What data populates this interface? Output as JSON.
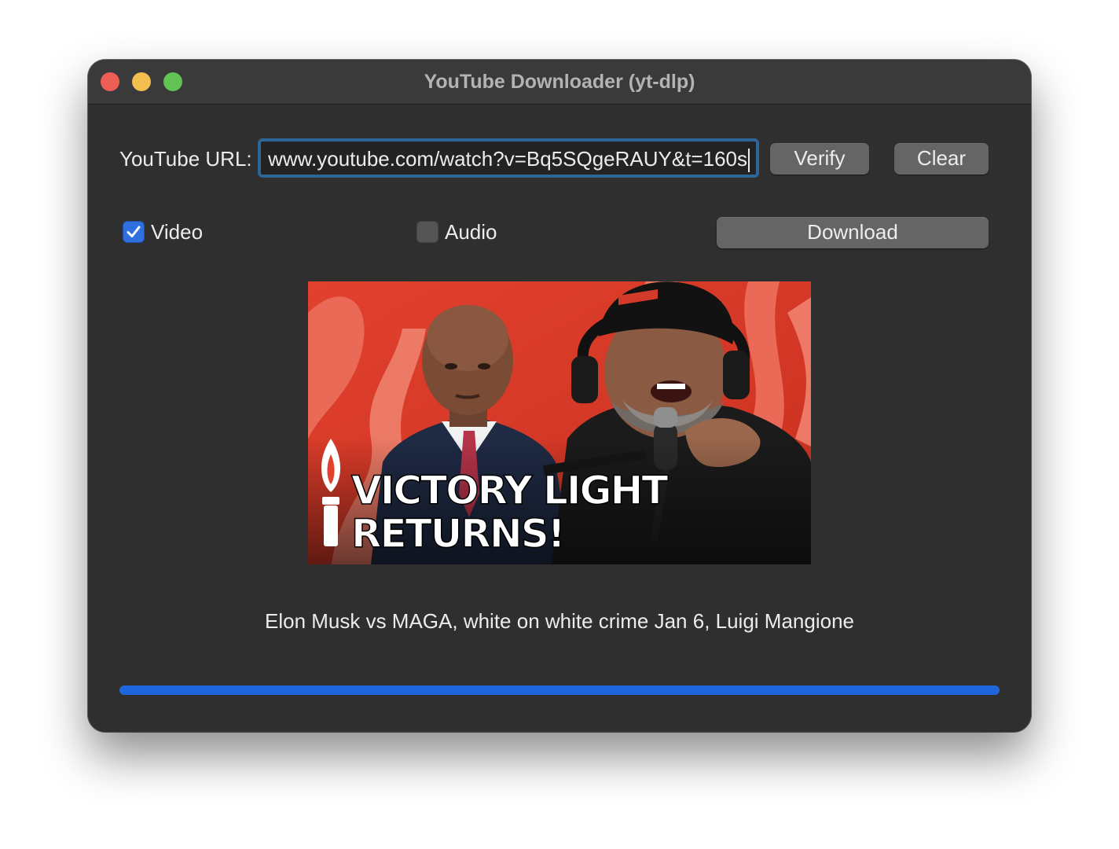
{
  "window": {
    "title": "YouTube Downloader (yt-dlp)"
  },
  "url_row": {
    "label": "YouTube URL:",
    "value": "www.youtube.com/watch?v=Bq5SQgeRAUY&t=160s",
    "verify_label": "Verify",
    "clear_label": "Clear"
  },
  "options": {
    "video_label": "Video",
    "video_checked": true,
    "audio_label": "Audio",
    "audio_checked": false,
    "download_label": "Download"
  },
  "thumbnail": {
    "headline_line1": "VICTORY LIGHT",
    "headline_line2": "RETURNS!"
  },
  "video": {
    "title": "Elon Musk vs MAGA, white on white crime Jan 6, Luigi Mangione"
  },
  "progress": {
    "fraction": 1.0,
    "color": "#1f66dc"
  },
  "colors": {
    "accent": "#2f6fe0",
    "window_bg": "#2f2f2f",
    "traffic_close": "#ee5e57",
    "traffic_min": "#f4be4f",
    "traffic_max": "#61c455"
  }
}
